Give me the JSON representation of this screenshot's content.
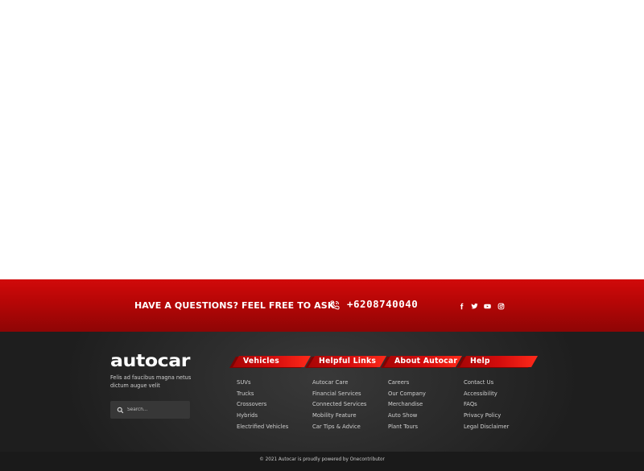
{
  "cta": {
    "title": "HAVE A QUESTIONS? FEEL FREE TO ASK",
    "phone": "+6208740040",
    "social_icons": [
      "facebook-icon",
      "twitter-icon",
      "youtube-icon",
      "instagram-icon"
    ]
  },
  "footer": {
    "brand": "autocar",
    "tagline": "Felis ad faucibus magna netus dictum augue velit",
    "search_placeholder": "Search...",
    "columns": [
      {
        "title": "Vehicles",
        "links": [
          "SUVs",
          "Trucks",
          "Crossovers",
          "Hybrids",
          "Electrified Vehicles"
        ]
      },
      {
        "title": "Helpful Links",
        "links": [
          "Autocar Care",
          "Financial Services",
          "Connected Services",
          "Mobility Feature",
          "Car Tips & Advice"
        ]
      },
      {
        "title": "About Autocar",
        "links": [
          "Careers",
          "Our Company",
          "Merchandise",
          "Auto Show",
          "Plant Tours"
        ]
      },
      {
        "title": "Help",
        "links": [
          "Contact Us",
          "Accessibility",
          "FAQs",
          "Privacy Policy",
          "Legal Disclaimer"
        ]
      }
    ],
    "copyright": "© 2021 Autocar is proudly powered by Onecontributor"
  },
  "colors": {
    "accent_red": "#c40808",
    "footer_bg": "#2a2a2a"
  }
}
